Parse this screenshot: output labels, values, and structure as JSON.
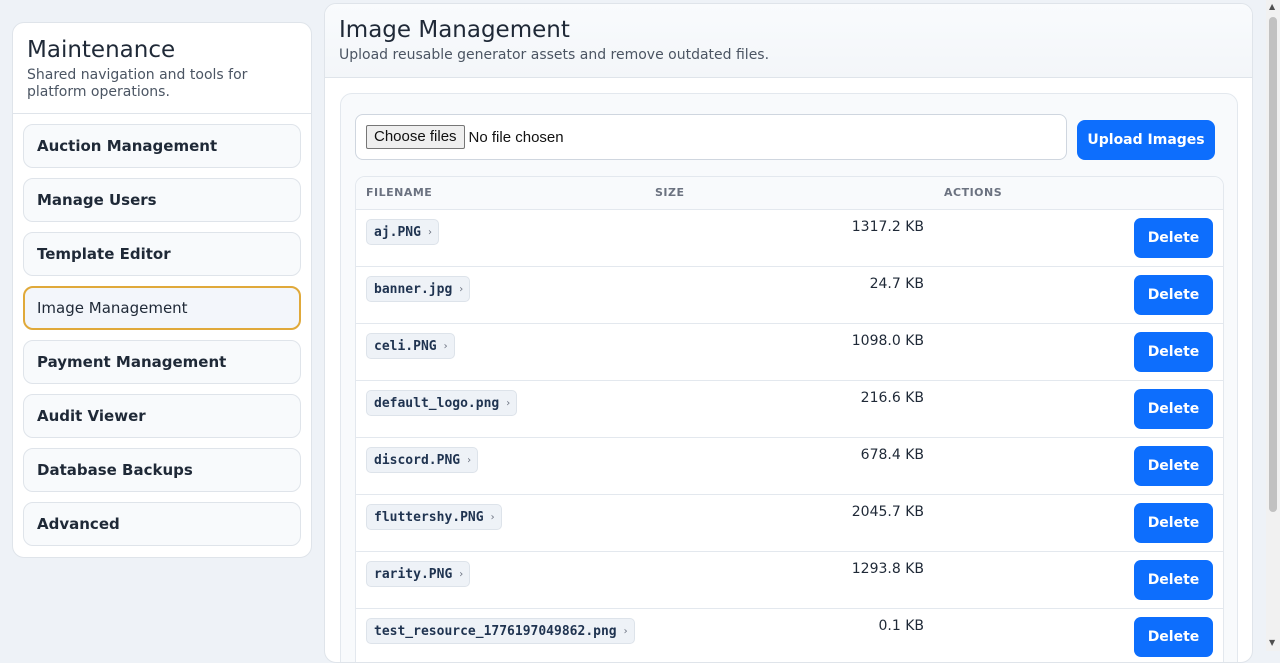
{
  "sidebar": {
    "title": "Maintenance",
    "subtitle": "Shared navigation and tools for platform operations.",
    "items": [
      {
        "label": "Auction Management",
        "active": false
      },
      {
        "label": "Manage Users",
        "active": false
      },
      {
        "label": "Template Editor",
        "active": false
      },
      {
        "label": "Image Management",
        "active": true
      },
      {
        "label": "Payment Management",
        "active": false
      },
      {
        "label": "Audit Viewer",
        "active": false
      },
      {
        "label": "Database Backups",
        "active": false
      },
      {
        "label": "Advanced",
        "active": false
      }
    ]
  },
  "main": {
    "title": "Image Management",
    "subtitle": "Upload reusable generator assets and remove outdated files.",
    "file_input": {
      "button_label": "Choose files",
      "status": "No file chosen"
    },
    "upload_label": "Upload Images",
    "table": {
      "headers": {
        "filename": "FILENAME",
        "size": "SIZE",
        "actions": "ACTIONS"
      },
      "delete_label": "Delete",
      "rows": [
        {
          "filename": "aj.PNG",
          "size": "1317.2 KB"
        },
        {
          "filename": "banner.jpg",
          "size": "24.7 KB"
        },
        {
          "filename": "celi.PNG",
          "size": "1098.0 KB"
        },
        {
          "filename": "default_logo.png",
          "size": "216.6 KB"
        },
        {
          "filename": "discord.PNG",
          "size": "678.4 KB"
        },
        {
          "filename": "fluttershy.PNG",
          "size": "2045.7 KB"
        },
        {
          "filename": "rarity.PNG",
          "size": "1293.8 KB"
        },
        {
          "filename": "test_resource_1776197049862.png",
          "size": "0.1 KB"
        }
      ]
    }
  },
  "colors": {
    "accent": "#0d6efd",
    "active_border": "#e0a93a"
  },
  "icons": {
    "expand": "chevron-right-icon",
    "scroll_up": "scroll-up-arrow-icon",
    "scroll_down": "scroll-down-arrow-icon"
  }
}
